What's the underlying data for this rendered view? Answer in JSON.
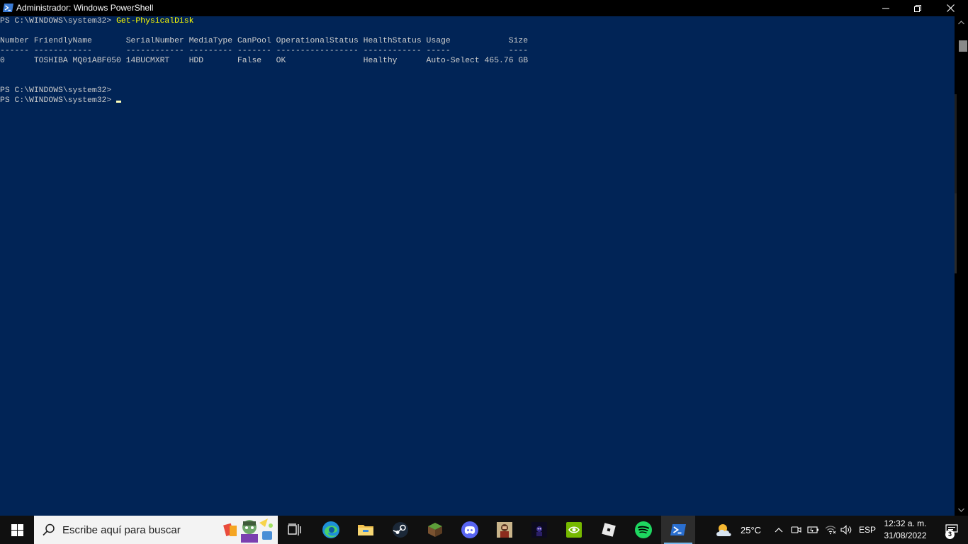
{
  "window": {
    "title": "Administrador: Windows PowerShell"
  },
  "console": {
    "prompt": "PS C:\\WINDOWS\\system32> ",
    "command": "Get-PhysicalDisk",
    "header": "Number FriendlyName       SerialNumber MediaType CanPool OperationalStatus HealthStatus Usage            Size",
    "separator": "------ ------------       ------------ --------- ------- ----------------- ------------ -----            ----",
    "rows": [
      "0      TOSHIBA MQ01ABF050 14BUCMXRT    HDD       False   OK                Healthy      Auto-Select 465.76 GB"
    ],
    "prompt_line_2": "PS C:\\WINDOWS\\system32>",
    "prompt_line_3": "PS C:\\WINDOWS\\system32> "
  },
  "taskbar": {
    "search_placeholder": "Escribe aquí para buscar",
    "apps": [
      {
        "name": "task-view",
        "icon": "task-view-icon"
      },
      {
        "name": "edge",
        "icon": "edge-icon"
      },
      {
        "name": "file-explorer",
        "icon": "folder-icon"
      },
      {
        "name": "steam",
        "icon": "steam-icon"
      },
      {
        "name": "minecraft",
        "icon": "minecraft-icon"
      },
      {
        "name": "discord",
        "icon": "discord-icon"
      },
      {
        "name": "game-1",
        "icon": "game-icon"
      },
      {
        "name": "game-2",
        "icon": "game-icon"
      },
      {
        "name": "nvidia",
        "icon": "nvidia-icon"
      },
      {
        "name": "roblox",
        "icon": "roblox-icon"
      },
      {
        "name": "spotify",
        "icon": "spotify-icon"
      },
      {
        "name": "powershell",
        "icon": "powershell-icon"
      }
    ],
    "weather_temp": "25°C",
    "language": "ESP",
    "time": "12:32 a. m.",
    "date": "31/08/2022",
    "notification_count": "3"
  },
  "colors": {
    "console_bg": "#012456",
    "console_text": "#cccccc",
    "command_text": "#ffff00",
    "taskbar_bg": "#101010",
    "accent": "#76b9ed"
  }
}
